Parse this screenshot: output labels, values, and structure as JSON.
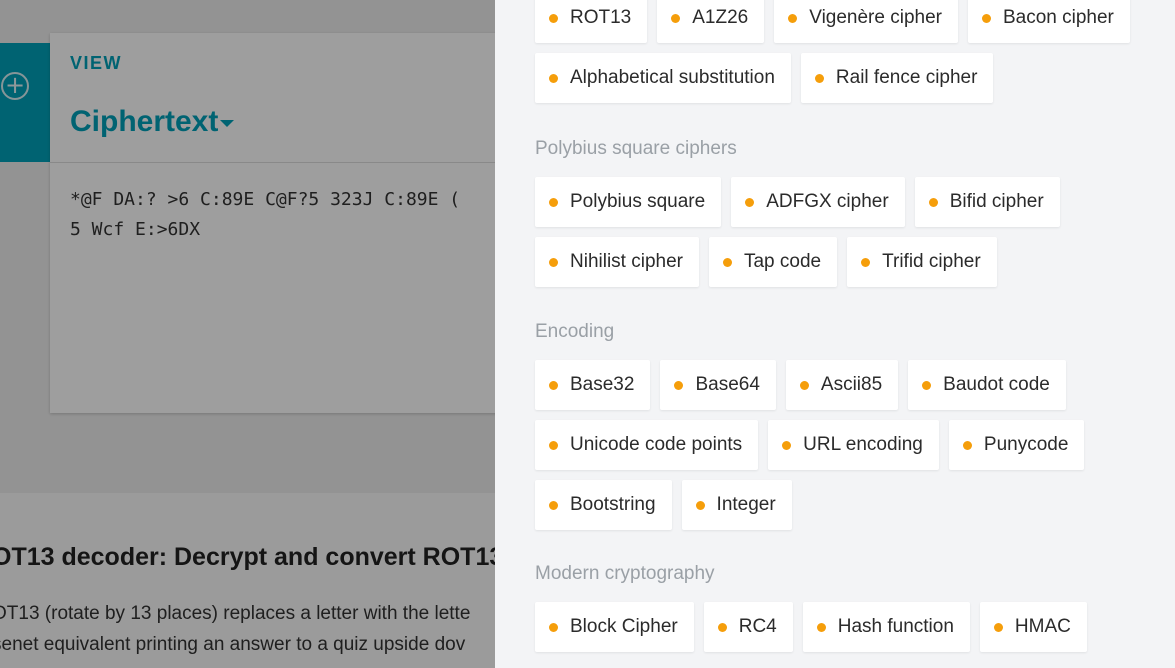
{
  "background": {
    "view_label": "VIEW",
    "view_title": "Ciphertext",
    "ciphertext_line1": "*@F DA:? >6 C:89E C@F?5 323J C:89E (",
    "ciphertext_line2": "5 Wcf E:>6DX",
    "heading": "OT13 decoder: Decrypt and convert ROT13",
    "para_line1": "OT13 (rotate by 13 places) replaces a letter with the lette",
    "para_line2": "senet equivalent printing an answer to a quiz upside dov"
  },
  "drawer": {
    "accent_color": "#f59e0b",
    "top_items": [
      "ROT13",
      "A1Z26",
      "Vigenère cipher",
      "Bacon cipher",
      "Alphabetical substitution",
      "Rail fence cipher"
    ],
    "sections": [
      {
        "title": "Polybius square ciphers",
        "items": [
          "Polybius square",
          "ADFGX cipher",
          "Bifid cipher",
          "Nihilist cipher",
          "Tap code",
          "Trifid cipher"
        ]
      },
      {
        "title": "Encoding",
        "items": [
          "Base32",
          "Base64",
          "Ascii85",
          "Baudot code",
          "Unicode code points",
          "URL encoding",
          "Punycode",
          "Bootstring",
          "Integer"
        ]
      },
      {
        "title": "Modern cryptography",
        "items": [
          "Block Cipher",
          "RC4",
          "Hash function",
          "HMAC"
        ]
      }
    ]
  }
}
